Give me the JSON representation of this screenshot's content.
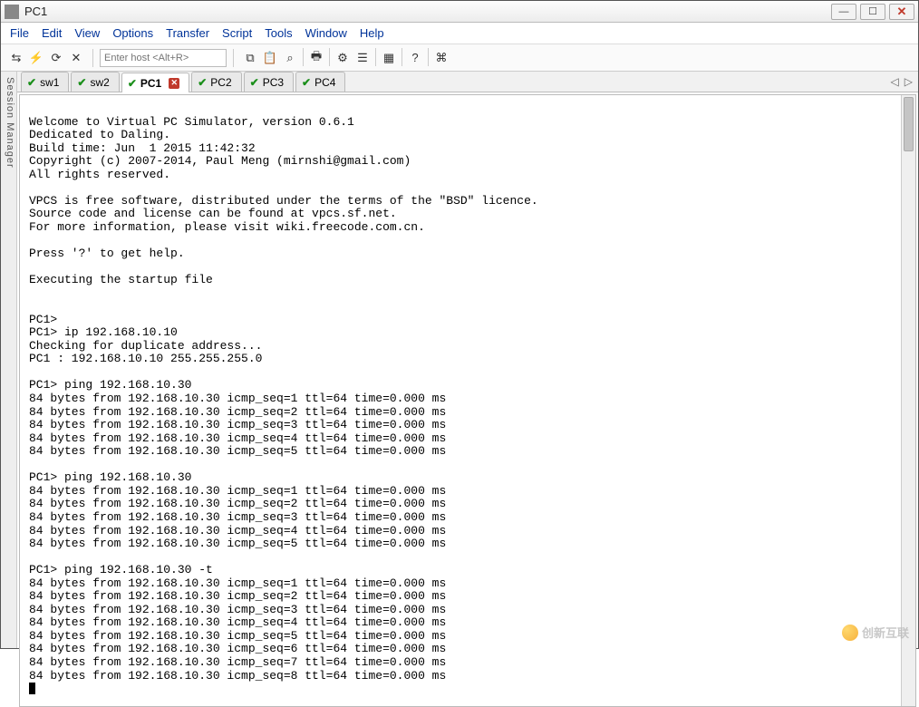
{
  "window": {
    "title": "PC1",
    "buttons": {
      "min": "—",
      "max": "☐",
      "close": "✕"
    }
  },
  "menu": [
    "File",
    "Edit",
    "View",
    "Options",
    "Transfer",
    "Script",
    "Tools",
    "Window",
    "Help"
  ],
  "toolbar": {
    "host_placeholder": "Enter host <Alt+R>",
    "buttons_left": [
      {
        "name": "connect-icon",
        "glyph": "⇆"
      },
      {
        "name": "quick-connect-icon",
        "glyph": "⚡"
      },
      {
        "name": "reconnect-icon",
        "glyph": "⟳"
      },
      {
        "name": "disconnect-icon",
        "glyph": "✕"
      }
    ],
    "buttons_right": [
      {
        "name": "copy-icon",
        "glyph": "⧉"
      },
      {
        "name": "paste-icon",
        "glyph": "📋"
      },
      {
        "name": "find-icon",
        "glyph": "⌕"
      },
      {
        "name": "print-icon",
        "glyph": "🖶"
      },
      {
        "name": "options-icon",
        "glyph": "⚙"
      },
      {
        "name": "session-options-icon",
        "glyph": "☰"
      },
      {
        "name": "tile-icon",
        "glyph": "▦"
      },
      {
        "name": "help-icon",
        "glyph": "?"
      },
      {
        "name": "script-icon",
        "glyph": "⌘"
      }
    ]
  },
  "sidebar_label": "Session Manager",
  "tabs": [
    {
      "label": "sw1",
      "active": false,
      "close": false
    },
    {
      "label": "sw2",
      "active": false,
      "close": false
    },
    {
      "label": "PC1",
      "active": true,
      "close": true
    },
    {
      "label": "PC2",
      "active": false,
      "close": false
    },
    {
      "label": "PC3",
      "active": false,
      "close": false
    },
    {
      "label": "PC4",
      "active": false,
      "close": false
    }
  ],
  "tabnav": {
    "prev": "◁",
    "next": "▷"
  },
  "terminal_lines": [
    "",
    "Welcome to Virtual PC Simulator, version 0.6.1",
    "Dedicated to Daling.",
    "Build time: Jun  1 2015 11:42:32",
    "Copyright (c) 2007-2014, Paul Meng (mirnshi@gmail.com)",
    "All rights reserved.",
    "",
    "VPCS is free software, distributed under the terms of the \"BSD\" licence.",
    "Source code and license can be found at vpcs.sf.net.",
    "For more information, please visit wiki.freecode.com.cn.",
    "",
    "Press '?' to get help.",
    "",
    "Executing the startup file",
    "",
    "",
    "PC1>",
    "PC1> ip 192.168.10.10",
    "Checking for duplicate address...",
    "PC1 : 192.168.10.10 255.255.255.0",
    "",
    "PC1> ping 192.168.10.30",
    "84 bytes from 192.168.10.30 icmp_seq=1 ttl=64 time=0.000 ms",
    "84 bytes from 192.168.10.30 icmp_seq=2 ttl=64 time=0.000 ms",
    "84 bytes from 192.168.10.30 icmp_seq=3 ttl=64 time=0.000 ms",
    "84 bytes from 192.168.10.30 icmp_seq=4 ttl=64 time=0.000 ms",
    "84 bytes from 192.168.10.30 icmp_seq=5 ttl=64 time=0.000 ms",
    "",
    "PC1> ping 192.168.10.30",
    "84 bytes from 192.168.10.30 icmp_seq=1 ttl=64 time=0.000 ms",
    "84 bytes from 192.168.10.30 icmp_seq=2 ttl=64 time=0.000 ms",
    "84 bytes from 192.168.10.30 icmp_seq=3 ttl=64 time=0.000 ms",
    "84 bytes from 192.168.10.30 icmp_seq=4 ttl=64 time=0.000 ms",
    "84 bytes from 192.168.10.30 icmp_seq=5 ttl=64 time=0.000 ms",
    "",
    "PC1> ping 192.168.10.30 -t",
    "84 bytes from 192.168.10.30 icmp_seq=1 ttl=64 time=0.000 ms",
    "84 bytes from 192.168.10.30 icmp_seq=2 ttl=64 time=0.000 ms",
    "84 bytes from 192.168.10.30 icmp_seq=3 ttl=64 time=0.000 ms",
    "84 bytes from 192.168.10.30 icmp_seq=4 ttl=64 time=0.000 ms",
    "84 bytes from 192.168.10.30 icmp_seq=5 ttl=64 time=0.000 ms",
    "84 bytes from 192.168.10.30 icmp_seq=6 ttl=64 time=0.000 ms",
    "84 bytes from 192.168.10.30 icmp_seq=7 ttl=64 time=0.000 ms",
    "84 bytes from 192.168.10.30 icmp_seq=8 ttl=64 time=0.000 ms"
  ],
  "watermark": "创新互联"
}
